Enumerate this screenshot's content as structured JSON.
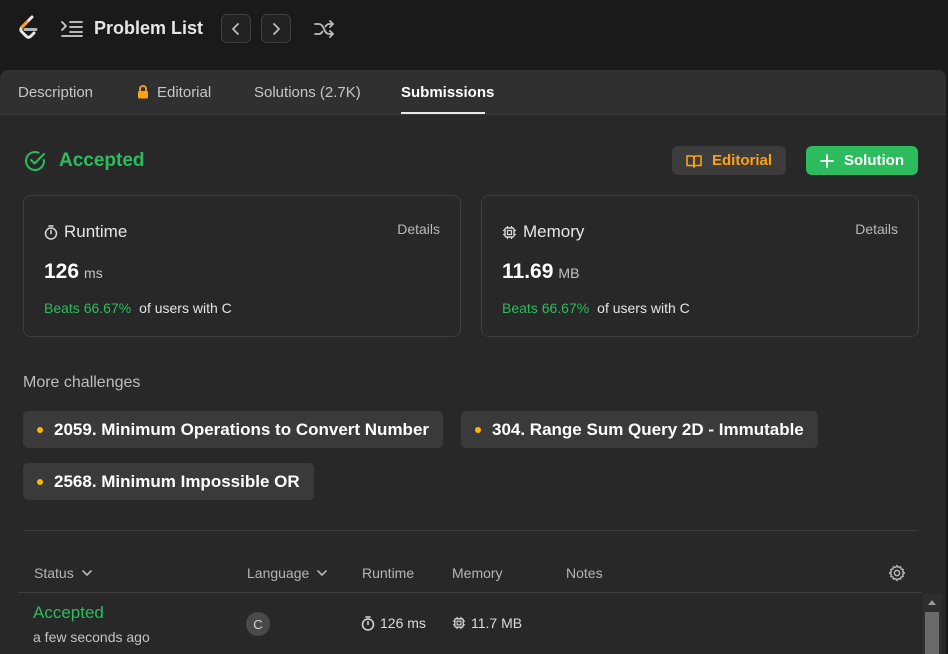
{
  "header": {
    "problem_list_label": "Problem List",
    "prev_icon": "chevron-left-icon",
    "next_icon": "chevron-right-icon",
    "shuffle_icon": "shuffle-icon"
  },
  "tabs": [
    {
      "label": "Description"
    },
    {
      "label": "Editorial",
      "icon": "lock-icon"
    },
    {
      "label": "Solutions (2.7K)"
    },
    {
      "label": "Submissions",
      "active": true
    }
  ],
  "result": {
    "status": "Accepted",
    "editorial_button": "Editorial",
    "solution_button": "Solution"
  },
  "runtime_card": {
    "title": "Runtime",
    "details": "Details",
    "value": "126",
    "unit": "ms",
    "beats": "Beats 66.67%",
    "beats_suffix": "of users with C"
  },
  "memory_card": {
    "title": "Memory",
    "details": "Details",
    "value": "11.69",
    "unit": "MB",
    "beats": "Beats 66.67%",
    "beats_suffix": "of users with C"
  },
  "more_challenges": {
    "title": "More challenges",
    "items": [
      "2059. Minimum Operations to Convert Number",
      "304. Range Sum Query 2D - Immutable",
      "2568. Minimum Impossible OR"
    ]
  },
  "table": {
    "headers": {
      "status": "Status",
      "language": "Language",
      "runtime": "Runtime",
      "memory": "Memory",
      "notes": "Notes"
    },
    "rows": [
      {
        "status": "Accepted",
        "time": "a few seconds ago",
        "language": "C",
        "runtime": "126 ms",
        "memory": "11.7 MB"
      }
    ]
  },
  "colors": {
    "accent_green": "#2cbb5d",
    "accent_orange": "#ffa116",
    "difficulty_dot": "#ffb800"
  }
}
